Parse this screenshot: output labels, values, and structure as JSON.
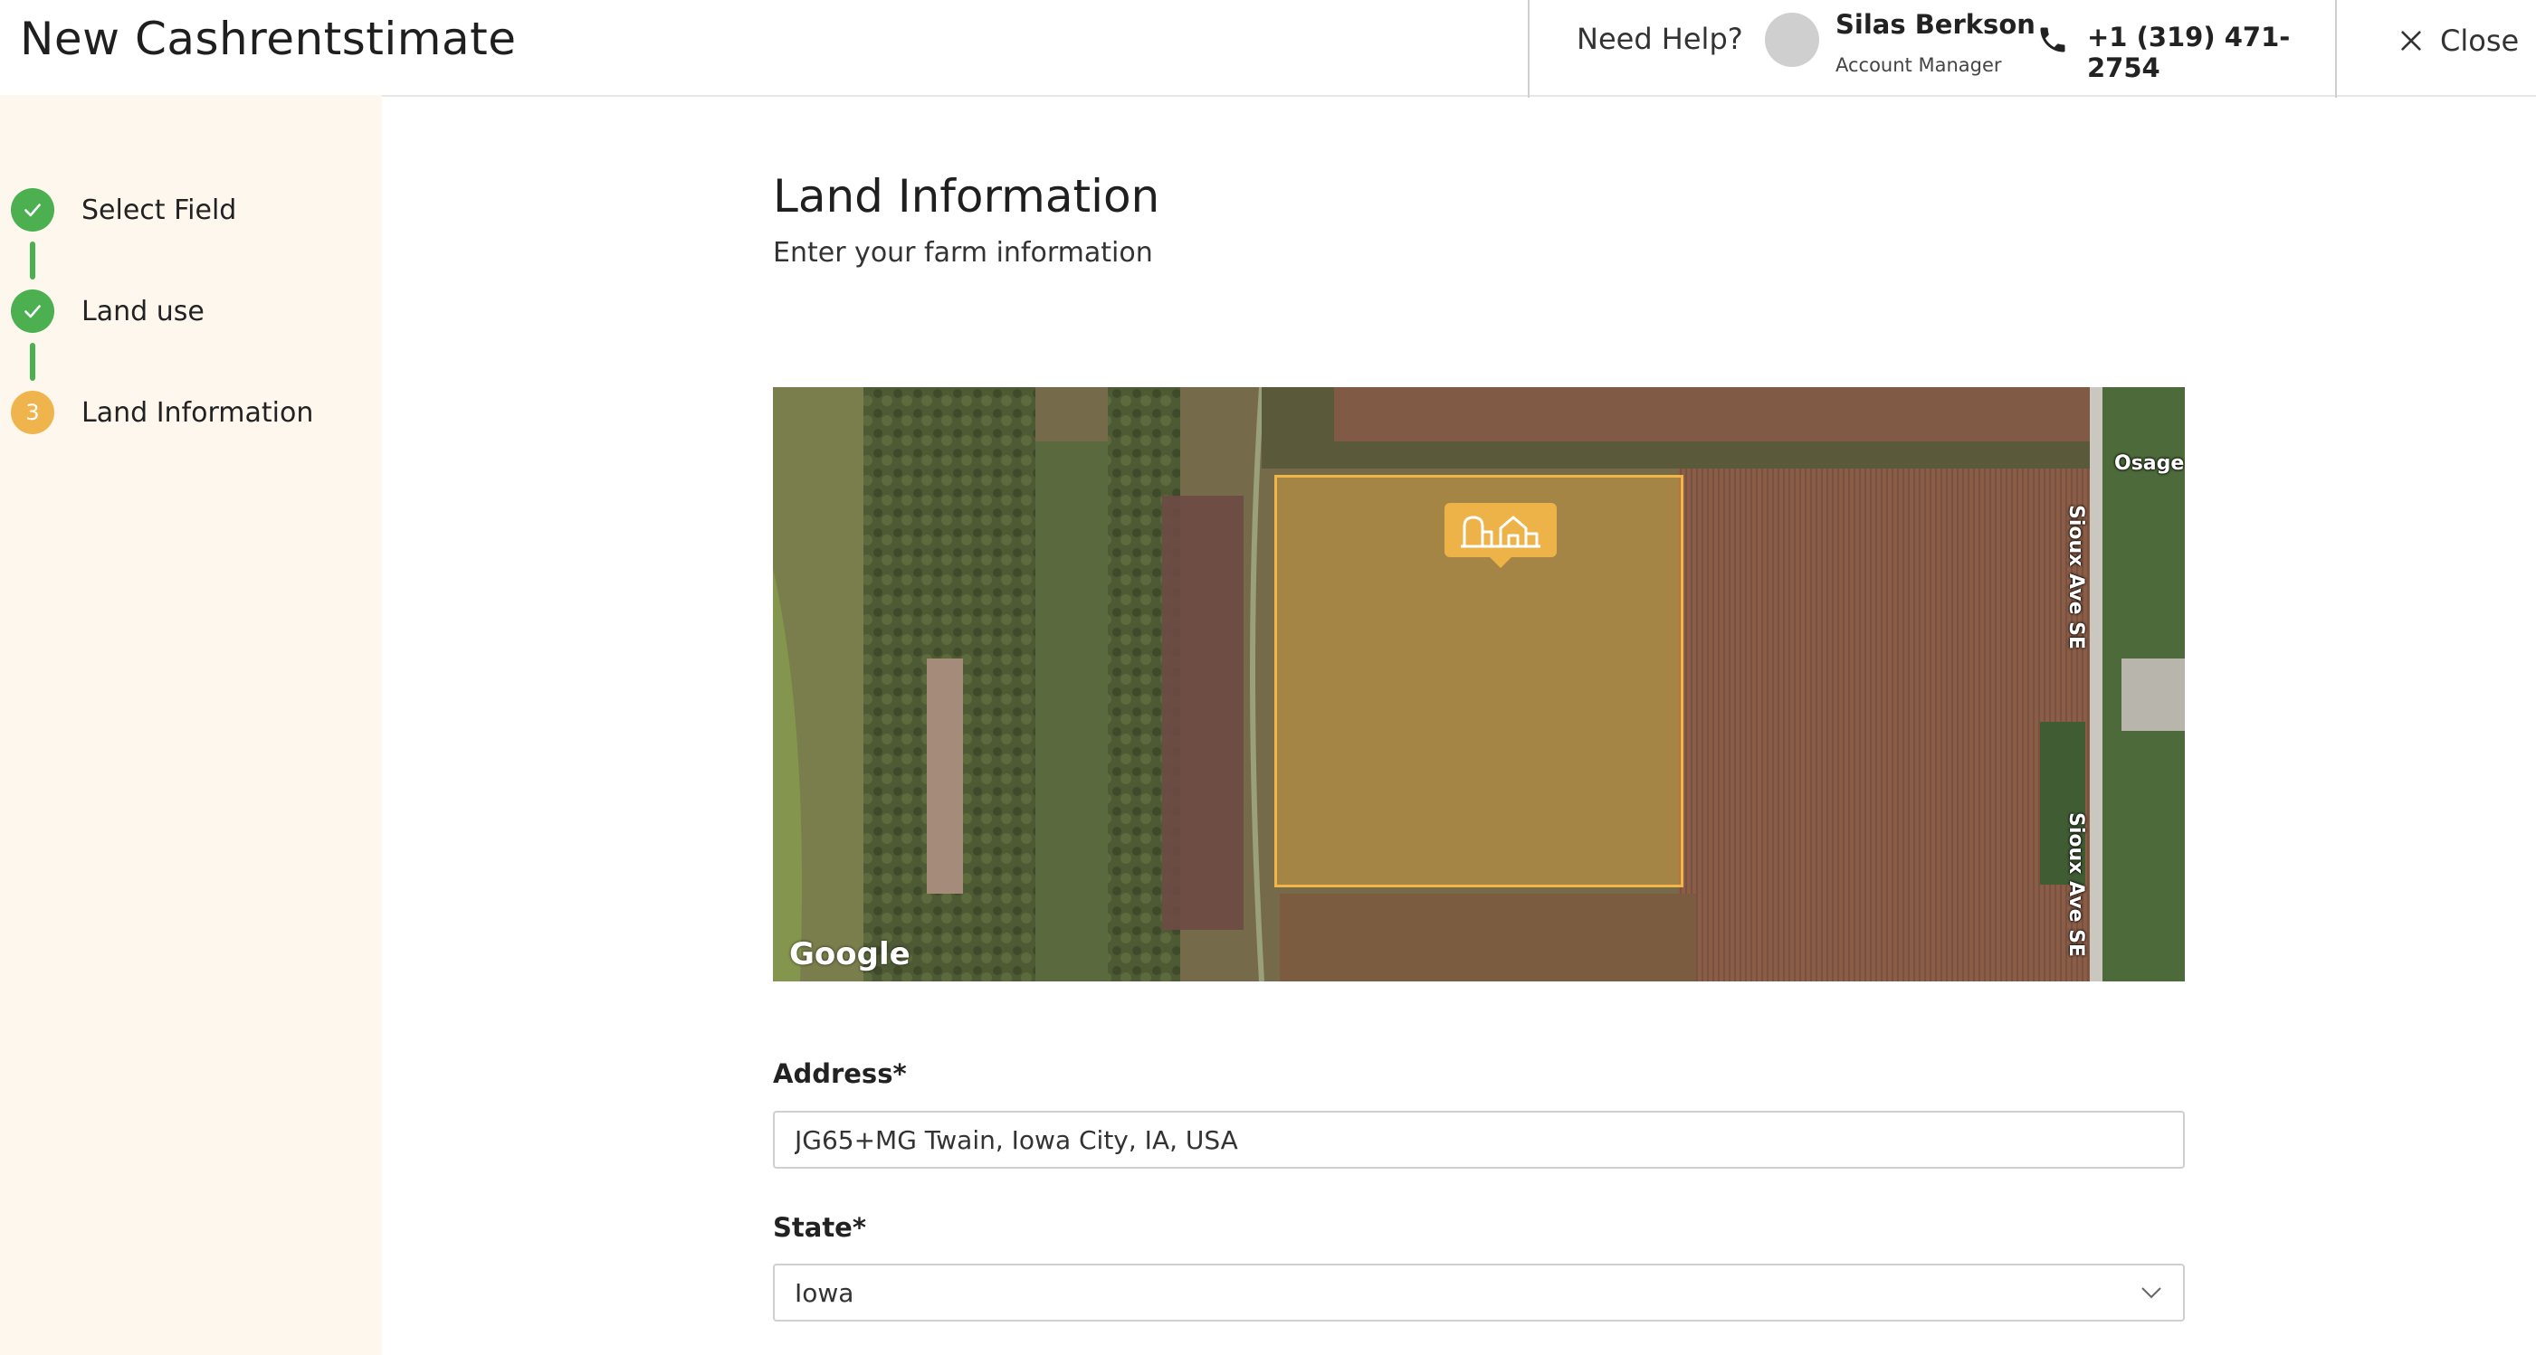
{
  "header": {
    "title": "New Cashrentstimate",
    "help": {
      "label": "Need Help?",
      "manager_name": "Silas Berkson",
      "manager_role": "Account Manager",
      "phone": "+1 (319) 471-2754",
      "phone_icon": "phone-icon"
    },
    "close_label": "Close",
    "close_icon": "close-icon"
  },
  "steps": [
    {
      "label": "Select Field",
      "status": "complete",
      "icon": "check-icon"
    },
    {
      "label": "Land use",
      "status": "complete",
      "icon": "check-icon"
    },
    {
      "label": "Land Information",
      "status": "current",
      "number": "3"
    }
  ],
  "main": {
    "title": "Land Information",
    "subtitle": "Enter your farm information",
    "map": {
      "attribution": "Google",
      "roads": [
        "Osage S",
        "Sioux Ave SE",
        "Sioux Ave SE"
      ],
      "marker_icon": "farm-buildings-icon",
      "selection_color": "#f2b648"
    },
    "fields": {
      "address": {
        "label": "Address",
        "required_mark": "*",
        "value": "JG65+MG Twain, Iowa City, IA, USA"
      },
      "state": {
        "label": "State",
        "required_mark": "*",
        "value": "Iowa",
        "icon": "chevron-down-icon"
      }
    }
  },
  "colors": {
    "complete": "#4caf50",
    "current": "#f0b44c",
    "sidebar_bg": "#fdf7ee"
  }
}
